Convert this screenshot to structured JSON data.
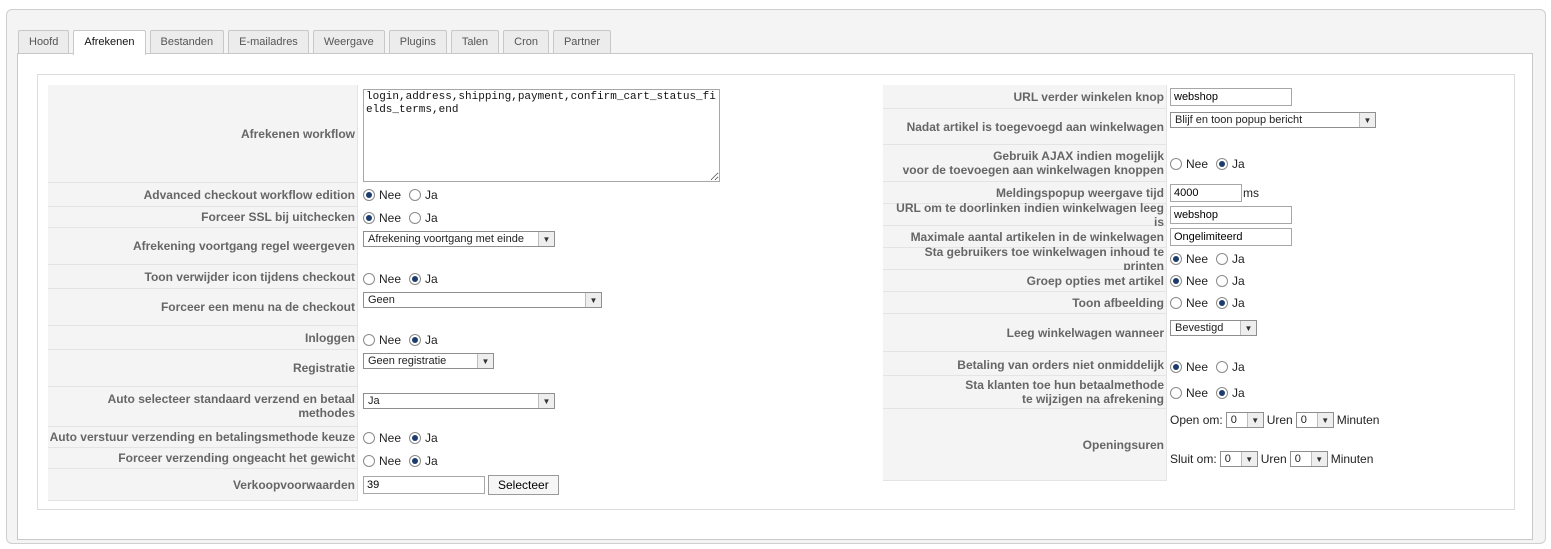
{
  "tabs": [
    "Hoofd",
    "Afrekenen",
    "Bestanden",
    "E-mailadres",
    "Weergave",
    "Plugins",
    "Talen",
    "Cron",
    "Partner"
  ],
  "active_tab": "Afrekenen",
  "radio": {
    "no": "Nee",
    "yes": "Ja"
  },
  "left": {
    "workflow": {
      "label": "Afrekenen workflow",
      "value": "login,address,shipping,payment,confirm_cart_status_fields_terms,end"
    },
    "advanced_edition": {
      "label": "Advanced checkout workflow edition",
      "selected": "Nee"
    },
    "force_ssl": {
      "label": "Forceer SSL bij uitchecken",
      "selected": "Nee"
    },
    "progress_line": {
      "label": "Afrekening voortgang regel weergeven",
      "value": "Afrekening voortgang met einde"
    },
    "remove_icon": {
      "label": "Toon verwijder icon tijdens checkout",
      "selected": "Ja"
    },
    "force_menu": {
      "label": "Forceer een menu na de checkout",
      "value": "Geen"
    },
    "login": {
      "label": "Inloggen",
      "selected": "Ja"
    },
    "registration": {
      "label": "Registratie",
      "value": "Geen registratie"
    },
    "auto_select": {
      "label": "Auto selecteer standaard verzend en betaal methodes",
      "value": "Ja"
    },
    "auto_submit": {
      "label": "Auto verstuur verzending en betalingsmethode keuze",
      "selected": "Ja"
    },
    "force_shipping": {
      "label": "Forceer verzending ongeacht het gewicht",
      "selected": "Ja"
    },
    "terms": {
      "label": "Verkoopvoorwaarden",
      "value": "39",
      "button": "Selecteer"
    }
  },
  "right": {
    "continue_url": {
      "label": "URL verder winkelen knop",
      "value": "webshop"
    },
    "after_add": {
      "label": "Nadat artikel is toegevoegd aan winkelwagen",
      "value": "Blijf en toon popup bericht"
    },
    "ajax": {
      "label_line1": "Gebruik AJAX indien mogelijk",
      "label_line2": "voor de toevoegen aan winkelwagen knoppen",
      "selected": "Ja"
    },
    "popup_time": {
      "label": "Meldingspopup weergave tijd",
      "value": "4000",
      "unit": "ms"
    },
    "empty_url": {
      "label": "URL om te doorlinken indien winkelwagen leeg is",
      "value": "webshop"
    },
    "max_items": {
      "label": "Maximale aantal artikelen in de winkelwagen",
      "value": "Ongelimiteerd"
    },
    "print_cart": {
      "label": "Sta gebruikers toe winkelwagen inhoud te printen",
      "selected": "Nee"
    },
    "group_options": {
      "label": "Groep opties met artikel",
      "selected": "Nee"
    },
    "show_image": {
      "label": "Toon afbeelding",
      "selected": "Ja"
    },
    "empty_when": {
      "label": "Leeg winkelwagen wanneer",
      "value": "Bevestigd"
    },
    "payment_not_immediate": {
      "label": "Betaling van orders niet onmiddelijk",
      "selected": "Nee"
    },
    "change_payment": {
      "label_line1": "Sta klanten toe hun betaalmethode",
      "label_line2": "te wijzigen na afrekening",
      "selected": "Ja"
    },
    "opening_hours": {
      "label": "Openingsuren",
      "open_label": "Open om:",
      "open_hour": "0",
      "open_min": "0",
      "close_label": "Sluit om:",
      "close_hour": "0",
      "close_min": "0",
      "hours_word": "Uren",
      "minutes_word": "Minuten"
    }
  }
}
